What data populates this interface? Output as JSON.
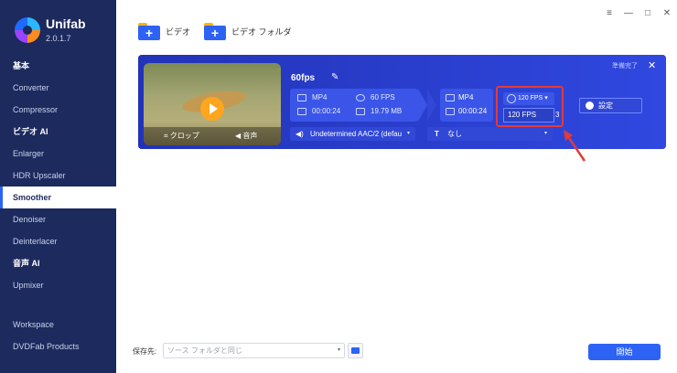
{
  "app": {
    "name": "Unifab",
    "version": "2.0.1.7"
  },
  "sidebar": {
    "items": [
      {
        "label": "基本",
        "type": "header"
      },
      {
        "label": "Converter",
        "type": "item"
      },
      {
        "label": "Compressor",
        "type": "item"
      },
      {
        "label": "ビデオ AI",
        "type": "header"
      },
      {
        "label": "Enlarger",
        "type": "item"
      },
      {
        "label": "HDR Upscaler",
        "type": "item"
      },
      {
        "label": "Smoother",
        "type": "item",
        "active": true
      },
      {
        "label": "Denoiser",
        "type": "item"
      },
      {
        "label": "Deinterlacer",
        "type": "item"
      },
      {
        "label": "音声 AI",
        "type": "header"
      },
      {
        "label": "Upmixer",
        "type": "item"
      },
      {
        "label": "Workspace",
        "type": "item"
      },
      {
        "label": "DVDFab Products",
        "type": "item"
      }
    ]
  },
  "window_controls": {
    "menu": "≡",
    "minimize": "—",
    "maximize": "□",
    "close": "✕"
  },
  "toolbar": {
    "add_video": "ビデオ",
    "add_folder": "ビデオ フォルダ"
  },
  "task": {
    "title": "60fps",
    "status": "準備完了",
    "close": "✕",
    "thumb_actions": {
      "crop": "クロップ",
      "audio": "音声"
    },
    "source": {
      "format": "MP4",
      "fps": "60 FPS",
      "duration": "00:00:24",
      "size": "19.79 MB"
    },
    "output": {
      "format": "MP4",
      "duration": "00:00:24"
    },
    "fps_select": "120 FPS",
    "fps_input": "120 FPS",
    "fps_extra": "3",
    "settings_label": "設定",
    "audio_track": "Undetermined AAC/2 (defau",
    "subtitle": "なし"
  },
  "footer": {
    "save_label": "保存先:",
    "save_placeholder": "ソース フォルダと同じ",
    "start_label": "開始"
  },
  "colors": {
    "sidebar_bg": "#1c2a5e",
    "card_bg": "#2a3fd0",
    "accent": "#2d63f5",
    "highlight": "#e23a3a"
  }
}
